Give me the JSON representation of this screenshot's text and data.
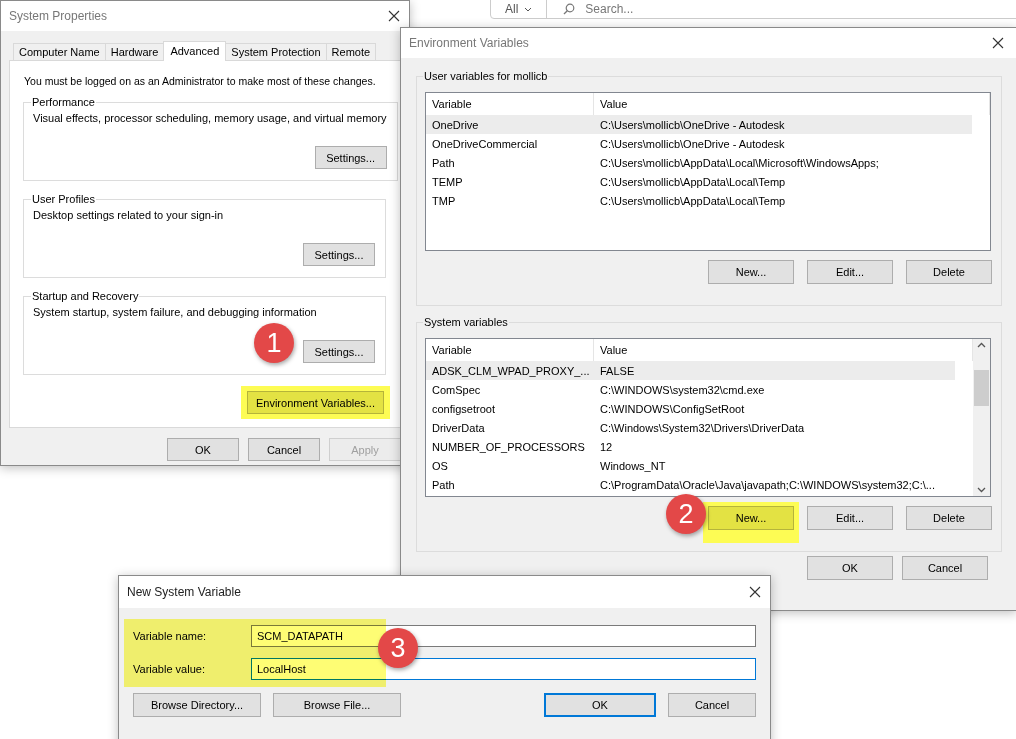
{
  "background_search": {
    "filter": "All",
    "placeholder": "Search..."
  },
  "system_properties": {
    "title": "System Properties",
    "tabs": [
      {
        "label": "Computer Name",
        "selected": false
      },
      {
        "label": "Hardware",
        "selected": false
      },
      {
        "label": "Advanced",
        "selected": true
      },
      {
        "label": "System Protection",
        "selected": false
      },
      {
        "label": "Remote",
        "selected": false
      }
    ],
    "admin_note": "You must be logged on as an Administrator to make most of these changes.",
    "groups": [
      {
        "title": "Performance",
        "description": "Visual effects, processor scheduling, memory usage, and virtual memory",
        "button": "Settings..."
      },
      {
        "title": "User Profiles",
        "description": "Desktop settings related to your sign-in",
        "button": "Settings..."
      },
      {
        "title": "Startup and Recovery",
        "description": "System startup, system failure, and debugging information",
        "button": "Settings..."
      }
    ],
    "env_button": {
      "label": "Environment Variables...",
      "highlighted": true
    },
    "buttons": [
      {
        "label": "OK",
        "disabled": false
      },
      {
        "label": "Cancel",
        "disabled": false
      },
      {
        "label": "Apply",
        "disabled": true
      }
    ]
  },
  "environment_variables": {
    "title": "Environment Variables",
    "sections": [
      {
        "title": "User variables for mollicb",
        "columns": [
          "Variable",
          "Value"
        ],
        "scrollable": false,
        "rows": [
          {
            "variable": "OneDrive",
            "value": "C:\\Users\\mollicb\\OneDrive - Autodesk",
            "selected": true
          },
          {
            "variable": "OneDriveCommercial",
            "value": "C:\\Users\\mollicb\\OneDrive - Autodesk",
            "selected": false
          },
          {
            "variable": "Path",
            "value": "C:\\Users\\mollicb\\AppData\\Local\\Microsoft\\WindowsApps;",
            "selected": false
          },
          {
            "variable": "TEMP",
            "value": "C:\\Users\\mollicb\\AppData\\Local\\Temp",
            "selected": false
          },
          {
            "variable": "TMP",
            "value": "C:\\Users\\mollicb\\AppData\\Local\\Temp",
            "selected": false
          }
        ],
        "buttons": [
          {
            "label": "New...",
            "highlighted": false
          },
          {
            "label": "Edit...",
            "highlighted": false
          },
          {
            "label": "Delete",
            "highlighted": false
          }
        ]
      },
      {
        "title": "System variables",
        "columns": [
          "Variable",
          "Value"
        ],
        "scrollable": true,
        "rows": [
          {
            "variable": "ADSK_CLM_WPAD_PROXY_...",
            "value": "FALSE",
            "selected": true
          },
          {
            "variable": "ComSpec",
            "value": "C:\\WINDOWS\\system32\\cmd.exe",
            "selected": false
          },
          {
            "variable": "configsetroot",
            "value": "C:\\WINDOWS\\ConfigSetRoot",
            "selected": false
          },
          {
            "variable": "DriverData",
            "value": "C:\\Windows\\System32\\Drivers\\DriverData",
            "selected": false
          },
          {
            "variable": "NUMBER_OF_PROCESSORS",
            "value": "12",
            "selected": false
          },
          {
            "variable": "OS",
            "value": "Windows_NT",
            "selected": false
          },
          {
            "variable": "Path",
            "value": "C:\\ProgramData\\Oracle\\Java\\javapath;C:\\WINDOWS\\system32;C:\\...",
            "selected": false
          }
        ],
        "buttons": [
          {
            "label": "New...",
            "highlighted": true
          },
          {
            "label": "Edit...",
            "highlighted": false
          },
          {
            "label": "Delete",
            "highlighted": false
          }
        ]
      }
    ],
    "buttons": [
      "OK",
      "Cancel"
    ]
  },
  "new_system_variable": {
    "title": "New System Variable",
    "highlighted": true,
    "fields": [
      {
        "label": "Variable name:",
        "value": "SCM_DATAPATH",
        "focused": false
      },
      {
        "label": "Variable value:",
        "value": "LocalHost",
        "focused": true
      }
    ],
    "buttons": [
      {
        "label": "Browse Directory...",
        "default": false
      },
      {
        "label": "Browse File...",
        "default": false
      },
      {
        "label": "OK",
        "default": true
      },
      {
        "label": "Cancel",
        "default": false
      }
    ]
  },
  "callouts": [
    {
      "number": "1"
    },
    {
      "number": "2"
    },
    {
      "number": "3"
    }
  ]
}
